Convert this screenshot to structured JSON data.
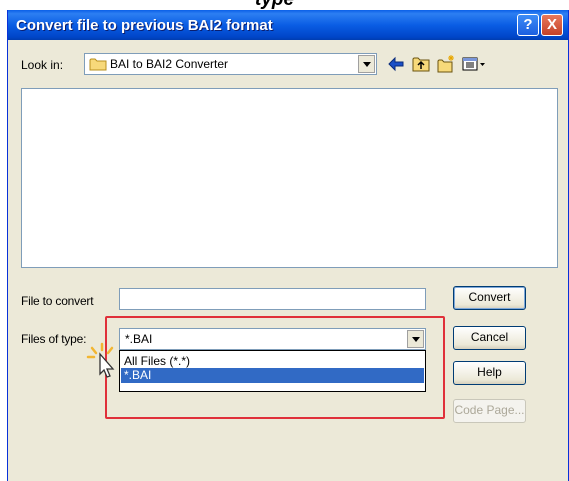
{
  "window": {
    "title": "Convert file to previous BAI2 format",
    "help_button": "?",
    "close_button": "X"
  },
  "look_in": {
    "label": "Look in:",
    "value": "BAI to BAI2 Converter"
  },
  "file_to_convert": {
    "label": "File to convert",
    "value": ""
  },
  "files_of_type": {
    "label": "Files of type:",
    "value": "*.BAI",
    "options": [
      "All Files (*.*)",
      "*.BAI"
    ],
    "selected_index": 1
  },
  "buttons": {
    "convert": "Convert",
    "cancel": "Cancel",
    "help": "Help",
    "code_page": "Code Page..."
  },
  "colors": {
    "titlebar": "#0a5de4",
    "dialog_bg": "#ece9d8",
    "selection": "#316ac5",
    "highlight_border": "#e0303a"
  }
}
